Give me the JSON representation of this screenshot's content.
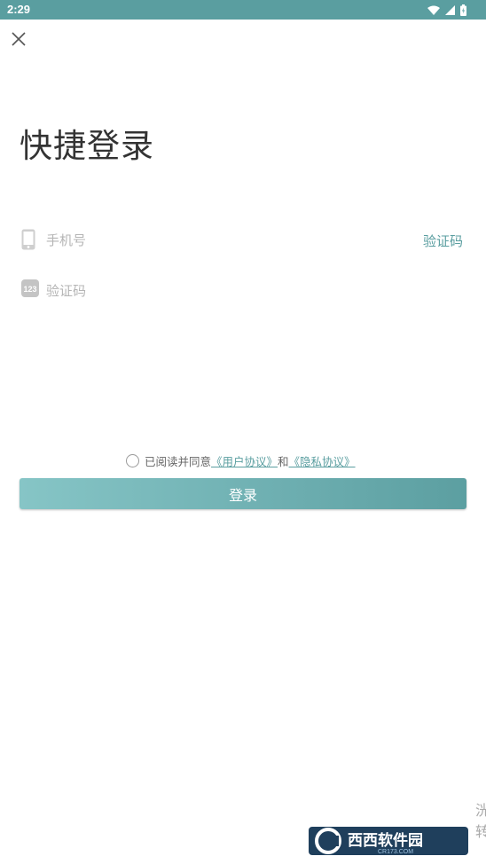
{
  "status_bar": {
    "time": "2:29",
    "icons": [
      "wifi-icon",
      "signal-icon",
      "battery-icon"
    ]
  },
  "header": {
    "close_icon": "close-icon"
  },
  "page": {
    "title": "快捷登录"
  },
  "form": {
    "phone": {
      "icon": "phone-icon",
      "placeholder": "手机号",
      "value": "",
      "get_code_label": "验证码"
    },
    "code": {
      "icon": "number-123-icon",
      "icon_text": "123",
      "placeholder": "验证码",
      "value": ""
    }
  },
  "agreement": {
    "checked": false,
    "prefix": "已阅读并同意",
    "user_agreement": "《用户协议》",
    "conjunction": "和",
    "privacy_policy": "《隐私协议》"
  },
  "login_button": {
    "label": "登录"
  },
  "watermark": {
    "text": "西西软件园",
    "subtext": "CR173.COM",
    "side_text": "洸 转"
  },
  "colors": {
    "accent": "#5a9ea0",
    "status_bar": "#5a9ea0",
    "button_start": "#86c5c6",
    "button_end": "#5c9fa1",
    "title": "#333333",
    "placeholder": "#b5b5b5"
  }
}
